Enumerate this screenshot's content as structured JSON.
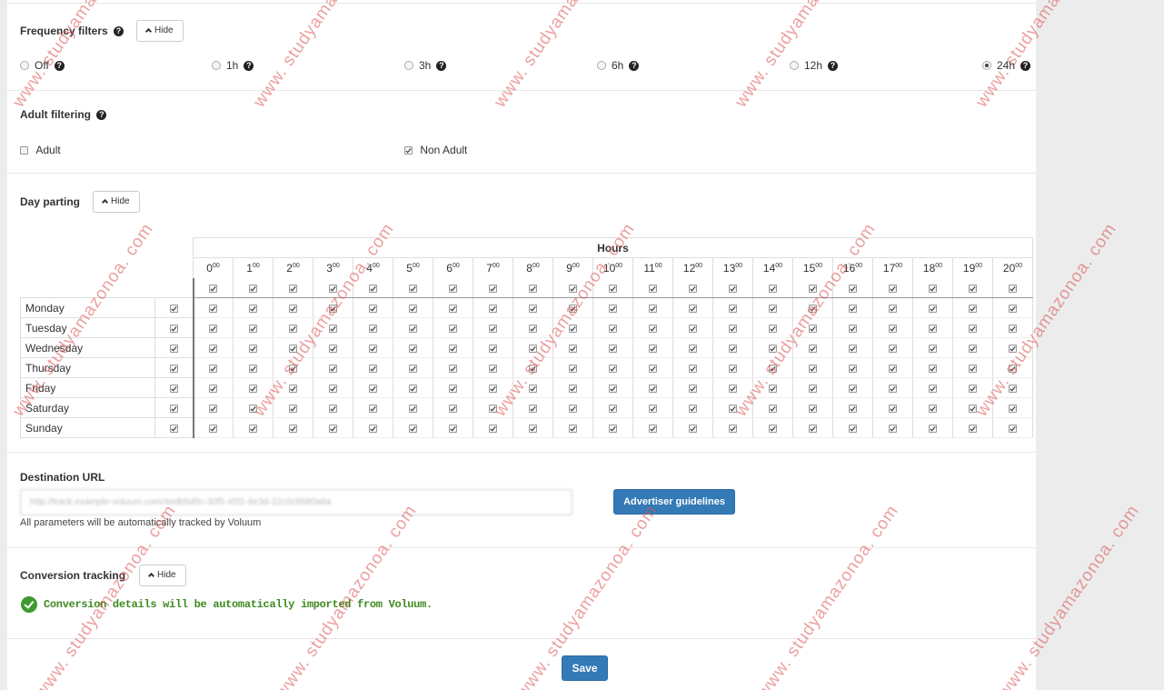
{
  "frequency": {
    "title": "Frequency filters",
    "hide_label": "Hide",
    "options": [
      {
        "label": "Off",
        "selected": false,
        "help": true
      },
      {
        "label": "1h",
        "selected": false,
        "help": true
      },
      {
        "label": "3h",
        "selected": false,
        "help": true
      },
      {
        "label": "6h",
        "selected": false,
        "help": true
      },
      {
        "label": "12h",
        "selected": false,
        "help": true
      },
      {
        "label": "24h",
        "selected": true,
        "help": true
      }
    ]
  },
  "adult": {
    "title": "Adult filtering",
    "options": [
      {
        "label": "Adult",
        "checked": false
      },
      {
        "label": "Non Adult",
        "checked": true
      }
    ]
  },
  "dayparting": {
    "title": "Day parting",
    "hide_label": "Hide",
    "hours_label": "Hours",
    "hour_suffix": "00",
    "hours": [
      "0",
      "1",
      "2",
      "3",
      "4",
      "5",
      "6",
      "7",
      "8",
      "9",
      "10",
      "11",
      "12",
      "13",
      "14",
      "15",
      "16",
      "17",
      "18",
      "19",
      "20"
    ],
    "days": [
      "Monday",
      "Tuesday",
      "Wednesday",
      "Thursday",
      "Friday",
      "Saturday",
      "Sunday"
    ],
    "all_checked": true
  },
  "destination": {
    "label": "Destination URL",
    "value": "http://track.example-voluum.com/4edb5d0c-30f5-45f1-8e3d-22c0c9580a6a",
    "hint": "All parameters will be automatically tracked by Voluum",
    "guidelines_button": "Advertiser guidelines"
  },
  "conversion": {
    "title": "Conversion tracking",
    "hide_label": "Hide",
    "message": "Conversion details will be automatically imported from Voluum."
  },
  "save_label": "Save",
  "watermark_text": "www. studyamazonoa. com",
  "colors": {
    "accent": "#337ab7",
    "success": "#3c9a2f",
    "watermark": "#dc5050"
  }
}
